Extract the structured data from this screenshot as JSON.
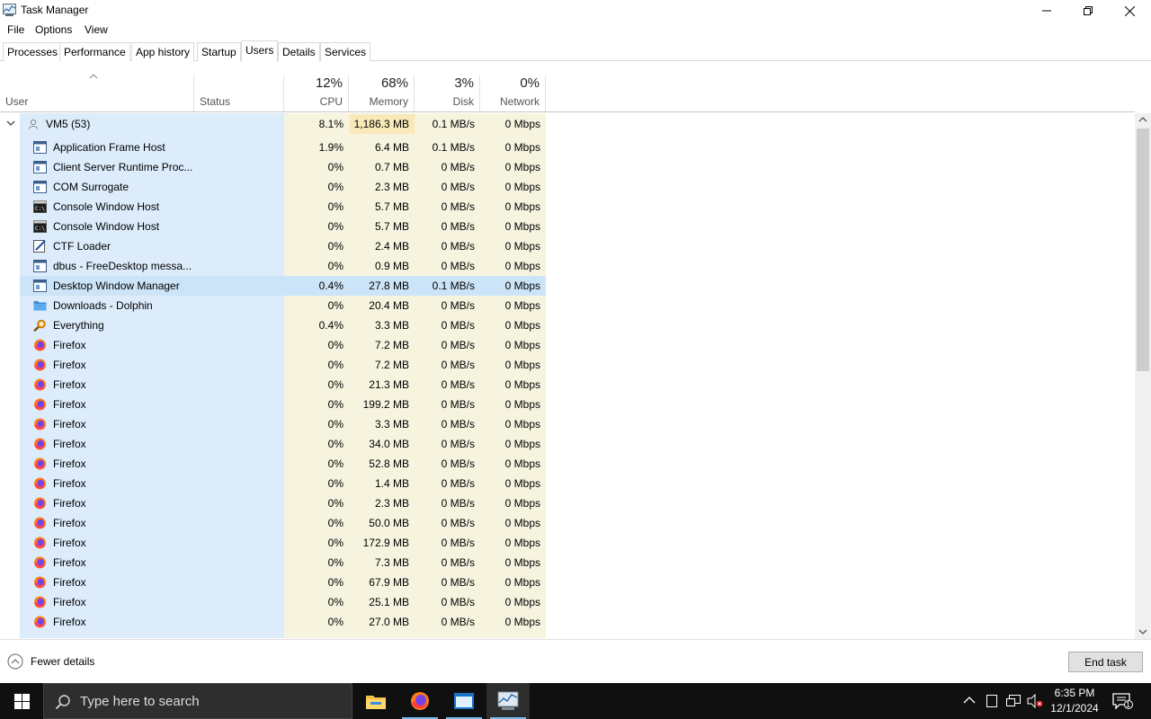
{
  "window": {
    "title": "Task Manager"
  },
  "menu": [
    "File",
    "Options",
    "View"
  ],
  "tabs": [
    "Processes",
    "Performance",
    "App history",
    "Startup",
    "Users",
    "Details",
    "Services"
  ],
  "active_tab": "Users",
  "columns": {
    "user": "User",
    "status": "Status",
    "cpu": {
      "pct": "12%",
      "label": "CPU"
    },
    "memory": {
      "pct": "68%",
      "label": "Memory"
    },
    "disk": {
      "pct": "3%",
      "label": "Disk"
    },
    "network": {
      "pct": "0%",
      "label": "Network"
    }
  },
  "group": {
    "name": "VM5 (53)",
    "cpu": "8.1%",
    "memory": "1,186.3 MB",
    "disk": "0.1 MB/s",
    "network": "0 Mbps"
  },
  "processes": [
    {
      "name": "Application Frame Host",
      "icon": "window-icon",
      "cpu": "1.9%",
      "memory": "6.4 MB",
      "disk": "0.1 MB/s",
      "network": "0 Mbps"
    },
    {
      "name": "Client Server Runtime Proc...",
      "icon": "window-icon",
      "cpu": "0%",
      "memory": "0.7 MB",
      "disk": "0 MB/s",
      "network": "0 Mbps"
    },
    {
      "name": "COM Surrogate",
      "icon": "window-icon",
      "cpu": "0%",
      "memory": "2.3 MB",
      "disk": "0 MB/s",
      "network": "0 Mbps"
    },
    {
      "name": "Console Window Host",
      "icon": "console-icon",
      "cpu": "0%",
      "memory": "5.7 MB",
      "disk": "0 MB/s",
      "network": "0 Mbps"
    },
    {
      "name": "Console Window Host",
      "icon": "console-icon",
      "cpu": "0%",
      "memory": "5.7 MB",
      "disk": "0 MB/s",
      "network": "0 Mbps"
    },
    {
      "name": "CTF Loader",
      "icon": "pen-icon",
      "cpu": "0%",
      "memory": "2.4 MB",
      "disk": "0 MB/s",
      "network": "0 Mbps"
    },
    {
      "name": "dbus - FreeDesktop messa...",
      "icon": "window-icon",
      "cpu": "0%",
      "memory": "0.9 MB",
      "disk": "0 MB/s",
      "network": "0 Mbps"
    },
    {
      "name": "Desktop Window Manager",
      "icon": "window-icon",
      "cpu": "0.4%",
      "memory": "27.8 MB",
      "disk": "0.1 MB/s",
      "network": "0 Mbps",
      "selected": true
    },
    {
      "name": "Downloads - Dolphin",
      "icon": "folder-icon",
      "cpu": "0%",
      "memory": "20.4 MB",
      "disk": "0 MB/s",
      "network": "0 Mbps"
    },
    {
      "name": "Everything",
      "icon": "magnifier-icon",
      "cpu": "0.4%",
      "memory": "3.3 MB",
      "disk": "0 MB/s",
      "network": "0 Mbps"
    },
    {
      "name": "Firefox",
      "icon": "firefox-icon",
      "cpu": "0%",
      "memory": "7.2 MB",
      "disk": "0 MB/s",
      "network": "0 Mbps"
    },
    {
      "name": "Firefox",
      "icon": "firefox-icon",
      "cpu": "0%",
      "memory": "7.2 MB",
      "disk": "0 MB/s",
      "network": "0 Mbps"
    },
    {
      "name": "Firefox",
      "icon": "firefox-icon",
      "cpu": "0%",
      "memory": "21.3 MB",
      "disk": "0 MB/s",
      "network": "0 Mbps"
    },
    {
      "name": "Firefox",
      "icon": "firefox-icon",
      "cpu": "0%",
      "memory": "199.2 MB",
      "disk": "0 MB/s",
      "network": "0 Mbps"
    },
    {
      "name": "Firefox",
      "icon": "firefox-icon",
      "cpu": "0%",
      "memory": "3.3 MB",
      "disk": "0 MB/s",
      "network": "0 Mbps"
    },
    {
      "name": "Firefox",
      "icon": "firefox-icon",
      "cpu": "0%",
      "memory": "34.0 MB",
      "disk": "0 MB/s",
      "network": "0 Mbps"
    },
    {
      "name": "Firefox",
      "icon": "firefox-icon",
      "cpu": "0%",
      "memory": "52.8 MB",
      "disk": "0 MB/s",
      "network": "0 Mbps"
    },
    {
      "name": "Firefox",
      "icon": "firefox-icon",
      "cpu": "0%",
      "memory": "1.4 MB",
      "disk": "0 MB/s",
      "network": "0 Mbps"
    },
    {
      "name": "Firefox",
      "icon": "firefox-icon",
      "cpu": "0%",
      "memory": "2.3 MB",
      "disk": "0 MB/s",
      "network": "0 Mbps"
    },
    {
      "name": "Firefox",
      "icon": "firefox-icon",
      "cpu": "0%",
      "memory": "50.0 MB",
      "disk": "0 MB/s",
      "network": "0 Mbps"
    },
    {
      "name": "Firefox",
      "icon": "firefox-icon",
      "cpu": "0%",
      "memory": "172.9 MB",
      "disk": "0 MB/s",
      "network": "0 Mbps"
    },
    {
      "name": "Firefox",
      "icon": "firefox-icon",
      "cpu": "0%",
      "memory": "7.3 MB",
      "disk": "0 MB/s",
      "network": "0 Mbps"
    },
    {
      "name": "Firefox",
      "icon": "firefox-icon",
      "cpu": "0%",
      "memory": "67.9 MB",
      "disk": "0 MB/s",
      "network": "0 Mbps"
    },
    {
      "name": "Firefox",
      "icon": "firefox-icon",
      "cpu": "0%",
      "memory": "25.1 MB",
      "disk": "0 MB/s",
      "network": "0 Mbps"
    },
    {
      "name": "Firefox",
      "icon": "firefox-icon",
      "cpu": "0%",
      "memory": "27.0 MB",
      "disk": "0 MB/s",
      "network": "0 Mbps"
    }
  ],
  "footer": {
    "fewer_details": "Fewer details",
    "end_task": "End task"
  },
  "taskbar": {
    "search_placeholder": "Type here to search",
    "time": "6:35 PM",
    "date": "12/1/2024",
    "notification_count": "1"
  },
  "colors": {
    "accent": "#cce4f7",
    "user_column": "#dcecfb",
    "data_column": "#f6f4df",
    "heat": "#f9e9b8"
  }
}
